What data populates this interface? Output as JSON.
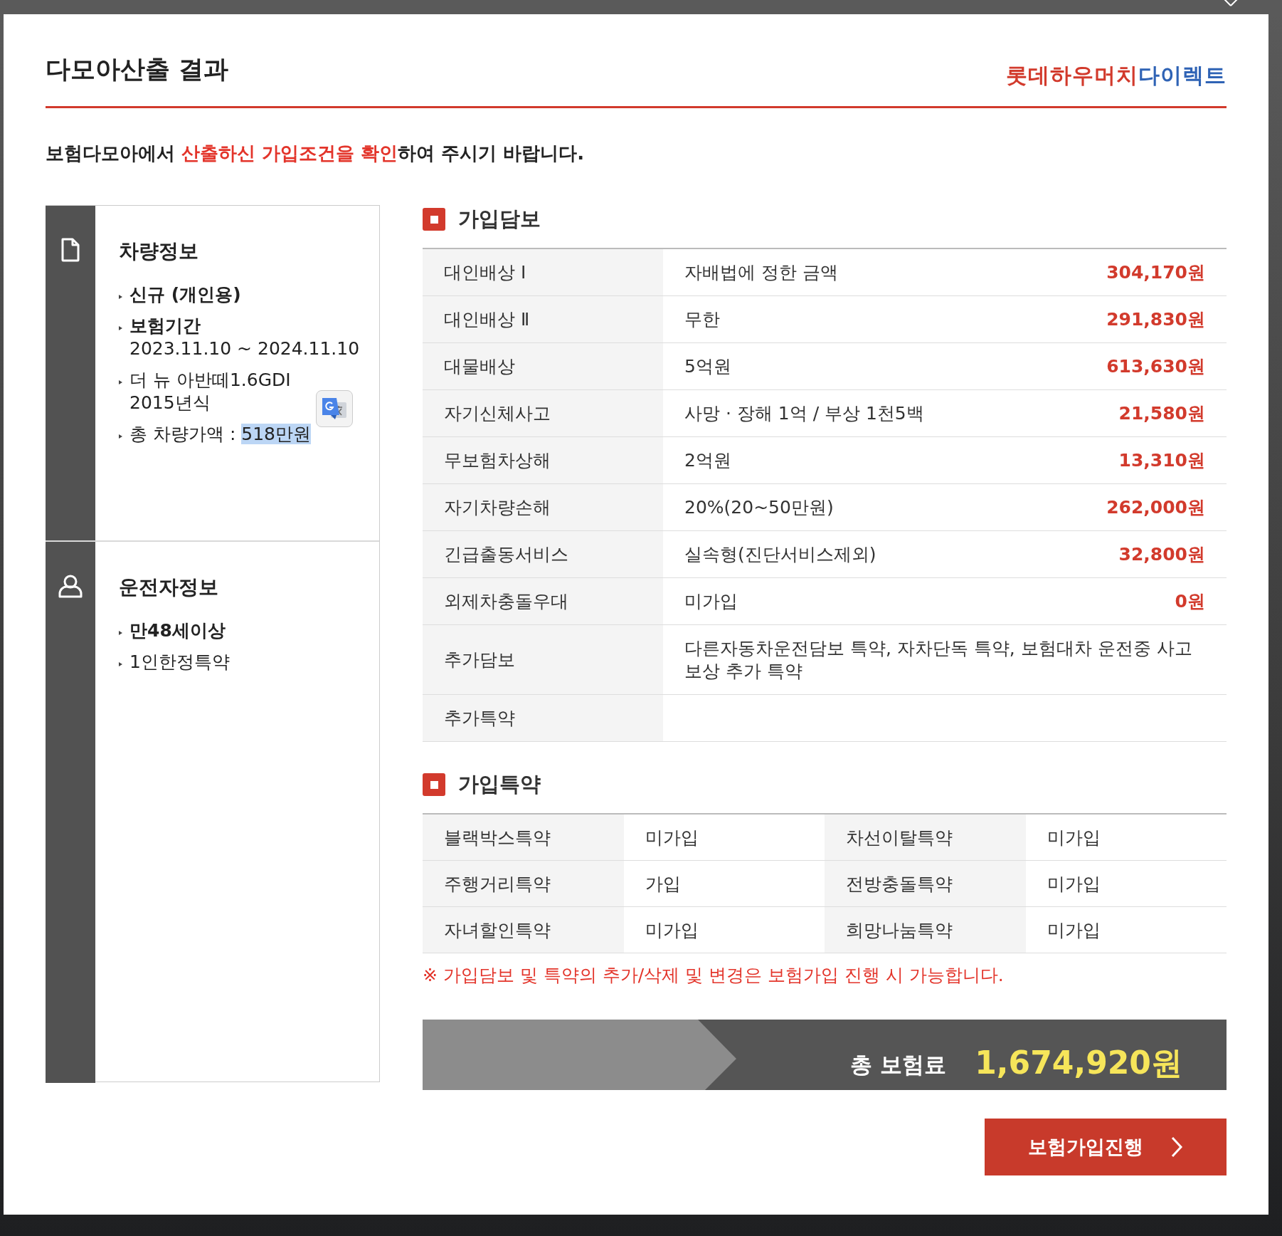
{
  "dialog": {
    "title": "다모아산출 결과",
    "logo": [
      {
        "text": "롯데하우머치",
        "color": "#d23a2c"
      },
      {
        "text": "다이렉트",
        "color": "#2f63b5"
      }
    ],
    "notice": [
      {
        "text": "보험다모아에서 ",
        "emphasis": false
      },
      {
        "text": "산출하신 가입조건을 확인",
        "emphasis": true
      },
      {
        "text": "하여 주시기 바랍니다.",
        "emphasis": false
      }
    ]
  },
  "vehicle_info": {
    "heading": "차량정보",
    "items": [
      {
        "lines": [
          "신규 (개인용)"
        ],
        "bold": true
      },
      {
        "lines": [
          "보험기간",
          "2023.11.10 ~ 2024.11.10"
        ],
        "bold": true
      },
      {
        "lines": [
          "더 뉴 아반떼1.6GDI",
          "2015년식"
        ],
        "bold": false
      },
      {
        "label": "총 차량가액 : ",
        "value": "518만원",
        "value_highlighted": true,
        "bold": false
      }
    ]
  },
  "driver_info": {
    "heading": "운전자정보",
    "items": [
      {
        "lines": [
          "만48세이상"
        ],
        "bold": true
      },
      {
        "lines": [
          "1인한정특약"
        ],
        "bold": false
      }
    ]
  },
  "coverage": {
    "heading": "가입담보",
    "rows": [
      {
        "name": "대인배상 Ⅰ",
        "detail": "자배법에 정한 금액",
        "amount": "304,170원"
      },
      {
        "name": "대인배상 Ⅱ",
        "detail": "무한",
        "amount": "291,830원"
      },
      {
        "name": "대물배상",
        "detail": "5억원",
        "amount": "613,630원"
      },
      {
        "name": "자기신체사고",
        "detail": "사망 · 장해 1억 / 부상 1천5백",
        "amount": "21,580원"
      },
      {
        "name": "무보험차상해",
        "detail": "2억원",
        "amount": "13,310원"
      },
      {
        "name": "자기차량손해",
        "detail": "20%(20~50만원)",
        "amount": "262,000원"
      },
      {
        "name": "긴급출동서비스",
        "detail": "실속형(진단서비스제외)",
        "amount": "32,800원"
      },
      {
        "name": "외제차충돌우대",
        "detail": "미가입",
        "amount": "0원"
      },
      {
        "name": "추가담보",
        "detail": "다른자동차운전담보 특약, 자차단독 특약, 보험대차 운전중 사고보상 추가 특약"
      },
      {
        "name": "추가특약"
      }
    ]
  },
  "riders": {
    "heading": "가입특약",
    "items": [
      {
        "name": "블랙박스특약",
        "status": "미가입"
      },
      {
        "name": "차선이탈특약",
        "status": "미가입"
      },
      {
        "name": "주행거리특약",
        "status": "가입"
      },
      {
        "name": "전방충돌특약",
        "status": "미가입"
      },
      {
        "name": "자녀할인특약",
        "status": "미가입"
      },
      {
        "name": "희망나눔특약",
        "status": "미가입"
      }
    ],
    "note": "※ 가입담보 및 특약의 추가/삭제 및 변경은 보험가입 진행 시 가능합니다."
  },
  "total": {
    "label": "총 보험료",
    "amount": "1,674,920원"
  },
  "proceed_button": {
    "label": "보험가입진행"
  }
}
